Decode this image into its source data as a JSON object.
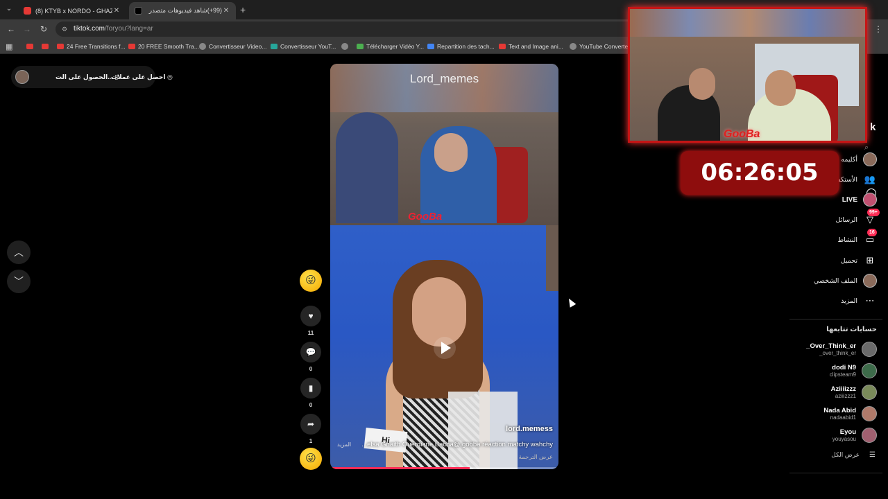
{
  "browser": {
    "tabs": [
      {
        "title": "(8) KTYB x NORDO - GHAZALI (",
        "icon": "youtube-icon"
      },
      {
        "title": "(99+)شاهد فيديوهات متصدر",
        "icon": "tiktok-icon"
      }
    ],
    "url_host": "tiktok.com",
    "url_path": "/foryou?lang=ar",
    "bookmarks": [
      {
        "label": "",
        "icon": "youtube-icon"
      },
      {
        "label": "",
        "icon": "youtube-icon"
      },
      {
        "label": "24 Free Transitions f...",
        "icon": "youtube-icon"
      },
      {
        "label": "20 FREE Smooth Tra...",
        "icon": "youtube-icon"
      },
      {
        "label": "Convertisseur Video...",
        "icon": "globe-icon"
      },
      {
        "label": "Convertisseur YouT...",
        "icon": "convert-icon"
      },
      {
        "label": "",
        "icon": "globe-icon"
      },
      {
        "label": "Télécharger Vidéo Y...",
        "icon": "download-icon"
      },
      {
        "label": "Repartition des tach...",
        "icon": "doc-icon"
      },
      {
        "label": "Text and Image ani...",
        "icon": "youtube-icon"
      },
      {
        "label": "YouTube Converter",
        "icon": "globe-icon"
      }
    ]
  },
  "topleft": {
    "get_app": "الحصول على الت...",
    "get_coins": "احصل على عملات"
  },
  "video": {
    "watermark": "Lord_memes",
    "top_logo": "GooBa",
    "sign_text": "Hi",
    "author": "lord.memess",
    "caption": "...elsa Ghaith Ouerdiane Bacha@ gooba réaction matchy wahchy",
    "more": "المزيد",
    "translate": "عرض الترجمة",
    "progress": 0.61
  },
  "actions": {
    "likes": "11",
    "comments": "0",
    "saves": "0",
    "shares": "1"
  },
  "overlay": {
    "webcam_logo": "GooBa",
    "timer": "06:26:05"
  },
  "sidebar": {
    "logo_partial": "k",
    "nav": [
      {
        "label": "أكليمه",
        "icon": "avatar"
      },
      {
        "label": "الأستكشاف",
        "icon": "users-icon"
      },
      {
        "label": "LIVE",
        "icon": "live-icon"
      },
      {
        "label": "الرسائل",
        "icon": "inbox-icon",
        "badge": "99+"
      },
      {
        "label": "النشاط",
        "icon": "message-icon",
        "badge": "16"
      },
      {
        "label": "تحميل",
        "icon": "upload-icon"
      },
      {
        "label": "الملف الشخصي",
        "icon": "avatar"
      },
      {
        "label": "المزيد",
        "icon": "more-icon"
      }
    ],
    "following_title": "حسابات تتابعها",
    "following": [
      {
        "name": "_Over_Think_er",
        "handle": "_over_think_er",
        "color": "#6a6a6a"
      },
      {
        "name": "dodi N9",
        "handle": "clipsteam9",
        "color": "#3d6b4a"
      },
      {
        "name": "Aziiiizzz",
        "handle": "aziiizzz1",
        "color": "#7a8a5a"
      },
      {
        "name": "Nada Abid",
        "handle": "nadaabid1",
        "color": "#b07a6a"
      },
      {
        "name": "Eyou",
        "handle": "youyasou",
        "color": "#a06070"
      }
    ],
    "see_all": "عرض الكل"
  }
}
